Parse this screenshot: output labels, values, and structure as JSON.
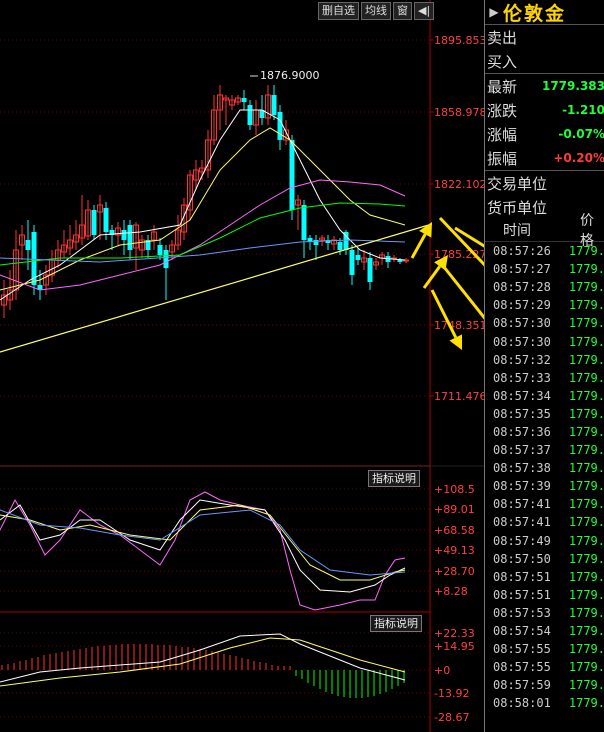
{
  "toolbar": {
    "buttons": [
      "删自选",
      "均线",
      "窗",
      "◀|"
    ]
  },
  "chart": {
    "price_axis": [
      "1895.853",
      "1858.978",
      "1822.102",
      "1785.227",
      "1748.351",
      "1711.476"
    ],
    "high_label": "1876.9000",
    "indicator_button": "指标说明",
    "ind1_axis": [
      "+108.5",
      "+89.01",
      "+68.58",
      "+49.13",
      "+28.70",
      "+8.28"
    ],
    "ind2_axis": [
      "+22.33",
      "+14.95",
      "+0",
      "-13.92",
      "-28.67"
    ],
    "colors": {
      "up": "#ff3232",
      "down": "#00ffff",
      "ma1": "#ffffff",
      "ma2": "#ffff66",
      "ma3": "#ff66ff",
      "ma4": "#00ff00",
      "ma5": "#6699ff",
      "trend": "#ffff66",
      "arrow": "#ffe000"
    }
  },
  "panel": {
    "title": "伦敦金",
    "rows": [
      {
        "label": "卖出",
        "value": "",
        "color": "#ddd"
      },
      {
        "label": "买入",
        "value": "",
        "color": "#ddd"
      },
      {
        "label": "最新",
        "value": "1779.383",
        "color": "#1eff3a"
      },
      {
        "label": "涨跌",
        "value": "-1.210",
        "color": "#1eff3a"
      },
      {
        "label": "涨幅",
        "value": "-0.07%",
        "color": "#1eff3a"
      },
      {
        "label": "振幅",
        "value": "+0.20%",
        "color": "#ff3b3b"
      },
      {
        "label": "交易单位",
        "value": "",
        "color": "#ddd"
      },
      {
        "label": "货币单位",
        "value": "",
        "color": "#ddd"
      }
    ],
    "tick_headers": [
      "时间",
      "价格"
    ],
    "ticks": [
      {
        "time": "08:57:26",
        "price": "1779."
      },
      {
        "time": "08:57:27",
        "price": "1779."
      },
      {
        "time": "08:57:28",
        "price": "1779."
      },
      {
        "time": "08:57:29",
        "price": "1779."
      },
      {
        "time": "08:57:30",
        "price": "1779."
      },
      {
        "time": "08:57:30",
        "price": "1779."
      },
      {
        "time": "08:57:32",
        "price": "1779."
      },
      {
        "time": "08:57:33",
        "price": "1779."
      },
      {
        "time": "08:57:34",
        "price": "1779."
      },
      {
        "time": "08:57:35",
        "price": "1779."
      },
      {
        "time": "08:57:36",
        "price": "1779."
      },
      {
        "time": "08:57:37",
        "price": "1779."
      },
      {
        "time": "08:57:38",
        "price": "1779."
      },
      {
        "time": "08:57:39",
        "price": "1779."
      },
      {
        "time": "08:57:41",
        "price": "1779."
      },
      {
        "time": "08:57:41",
        "price": "1779."
      },
      {
        "time": "08:57:49",
        "price": "1779."
      },
      {
        "time": "08:57:50",
        "price": "1779."
      },
      {
        "time": "08:57:51",
        "price": "1779."
      },
      {
        "time": "08:57:51",
        "price": "1779."
      },
      {
        "time": "08:57:53",
        "price": "1779."
      },
      {
        "time": "08:57:54",
        "price": "1779."
      },
      {
        "time": "08:57:55",
        "price": "1779."
      },
      {
        "time": "08:57:55",
        "price": "1779."
      },
      {
        "time": "08:57:59",
        "price": "1779."
      },
      {
        "time": "08:58:01",
        "price": "1779."
      }
    ]
  }
}
